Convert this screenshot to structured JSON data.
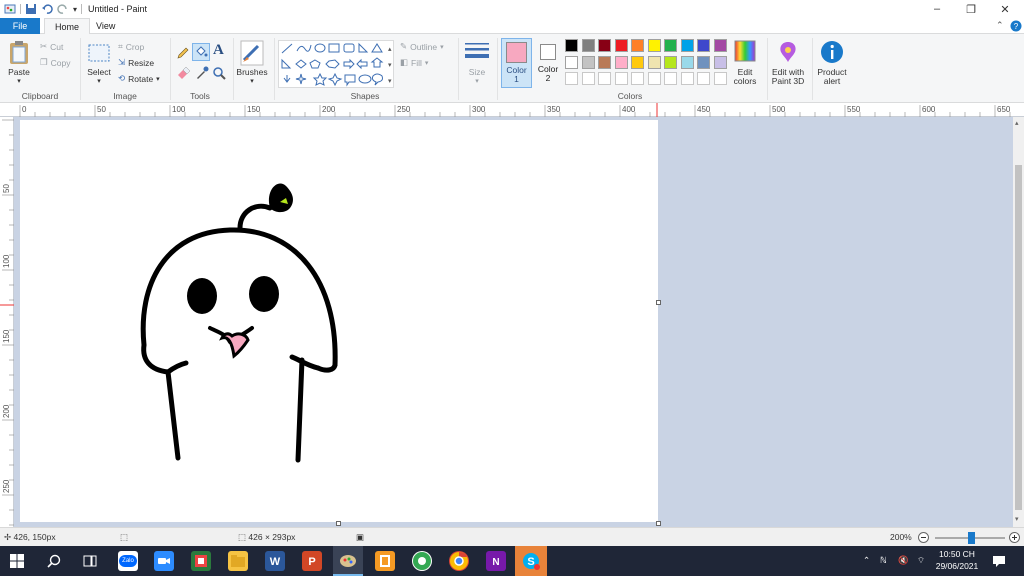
{
  "window": {
    "title": "Untitled - Paint"
  },
  "tabs": {
    "file": "File",
    "home": "Home",
    "view": "View"
  },
  "clipboard": {
    "paste": "Paste",
    "cut": "Cut",
    "copy": "Copy",
    "group": "Clipboard"
  },
  "image": {
    "select": "Select",
    "crop": "Crop",
    "resize": "Resize",
    "rotate": "Rotate",
    "group": "Image"
  },
  "tools": {
    "group": "Tools"
  },
  "brushes": {
    "label": "Brushes"
  },
  "shapes": {
    "outline": "Outline",
    "fill": "Fill",
    "group": "Shapes"
  },
  "size": {
    "label": "Size"
  },
  "colors": {
    "color1": "Color\n1",
    "color1_a": "Color",
    "color1_b": "1",
    "color2_a": "Color",
    "color2_b": "2",
    "edit_a": "Edit",
    "edit_b": "colors",
    "group": "Colors",
    "color1_value": "#f7a8c0",
    "color2_value": "#ffffff",
    "palette_row1": [
      "#000000",
      "#7f7f7f",
      "#880015",
      "#ed1c24",
      "#ff7f27",
      "#fff200",
      "#22b14c",
      "#00a2e8",
      "#3f48cc",
      "#a349a4"
    ],
    "palette_row2": [
      "#ffffff",
      "#c3c3c3",
      "#b97a57",
      "#ffaec9",
      "#ffc90e",
      "#efe4b0",
      "#b5e61d",
      "#99d9ea",
      "#7092be",
      "#c8bfe7"
    ]
  },
  "paint3d": {
    "a": "Edit with",
    "b": "Paint 3D"
  },
  "product": {
    "a": "Product",
    "b": "alert"
  },
  "ruler": {
    "h_labels": [
      "0",
      "50",
      "100",
      "150",
      "200",
      "250",
      "300",
      "350",
      "400",
      "450",
      "500",
      "550",
      "600",
      "650"
    ],
    "v_labels": [
      "50",
      "100",
      "150",
      "200",
      "250"
    ]
  },
  "status": {
    "cursor": "426, 150px",
    "size": "426 × 293px",
    "zoom": "200%"
  },
  "taskbar": {
    "time": "10:50 CH",
    "date": "29/06/2021",
    "zalo": "Zalo"
  }
}
